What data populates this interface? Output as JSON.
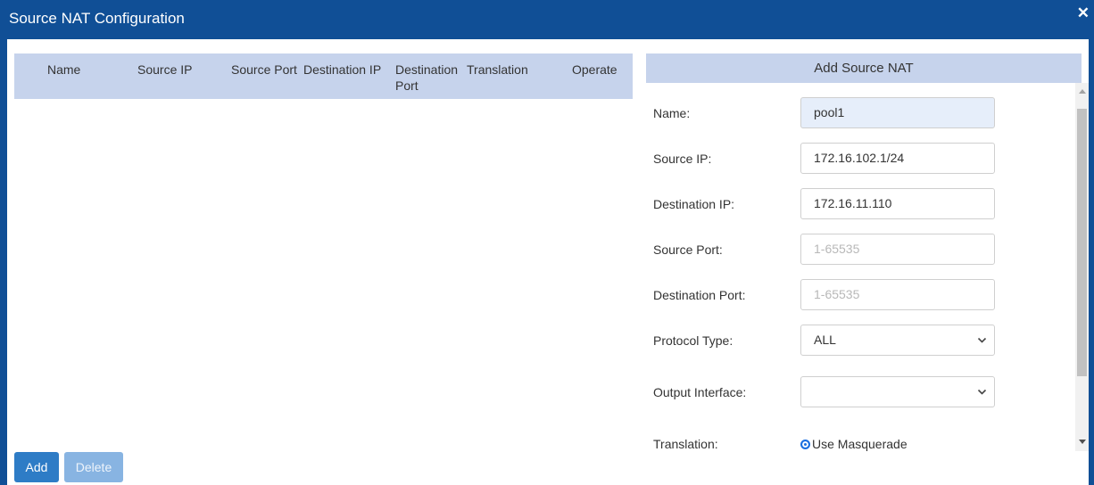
{
  "dialog": {
    "title": "Source NAT Configuration",
    "close_glyph": "✕"
  },
  "table": {
    "columns": [
      "Name",
      "Source IP",
      "Source Port",
      "Destination IP",
      "Destination Port",
      "Translation",
      "Operate"
    ],
    "rows": []
  },
  "form": {
    "title": "Add Source NAT",
    "name": {
      "label": "Name:",
      "value": "pool1"
    },
    "source_ip": {
      "label": "Source IP:",
      "value": "172.16.102.1/24"
    },
    "destination_ip": {
      "label": "Destination IP:",
      "value": "172.16.11.110"
    },
    "source_port": {
      "label": "Source Port:",
      "placeholder": "1-65535"
    },
    "destination_port": {
      "label": "Destination Port:",
      "placeholder": "1-65535"
    },
    "protocol_type": {
      "label": "Protocol Type:",
      "value": "ALL"
    },
    "output_interface": {
      "label": "Output Interface:",
      "value": ""
    },
    "translation": {
      "label": "Translation:",
      "option": "Use Masquerade",
      "selected": true
    }
  },
  "buttons": {
    "add": "Add",
    "delete": "Delete"
  },
  "colors": {
    "titlebar": "#104f96",
    "header": "#c6d3ec",
    "primary": "#2e7cc6",
    "primary_disabled": "#88b4e2",
    "radio": "#1a6fe0"
  }
}
